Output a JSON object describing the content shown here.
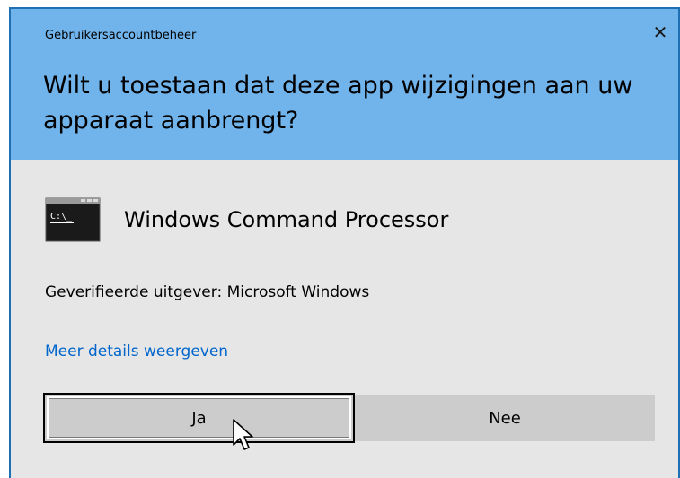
{
  "dialog": {
    "app_title": "Gebruikersaccountbeheer",
    "close_glyph": "✕",
    "question": "Wilt u toestaan dat deze app wijzigingen aan uw apparaat aanbrengt?",
    "app_icon": "command-prompt-icon",
    "app_icon_text": "C:\\_",
    "app_name": "Windows Command Processor",
    "publisher": "Geverifieerde uitgever: Microsoft Windows",
    "details_link": "Meer details weergeven",
    "yes_label": "Ja",
    "no_label": "Nee"
  },
  "colors": {
    "header": "#71b4ec",
    "body": "#e6e6e6",
    "link": "#0066cc",
    "button": "#cccccc",
    "border": "#1f6fb5"
  }
}
